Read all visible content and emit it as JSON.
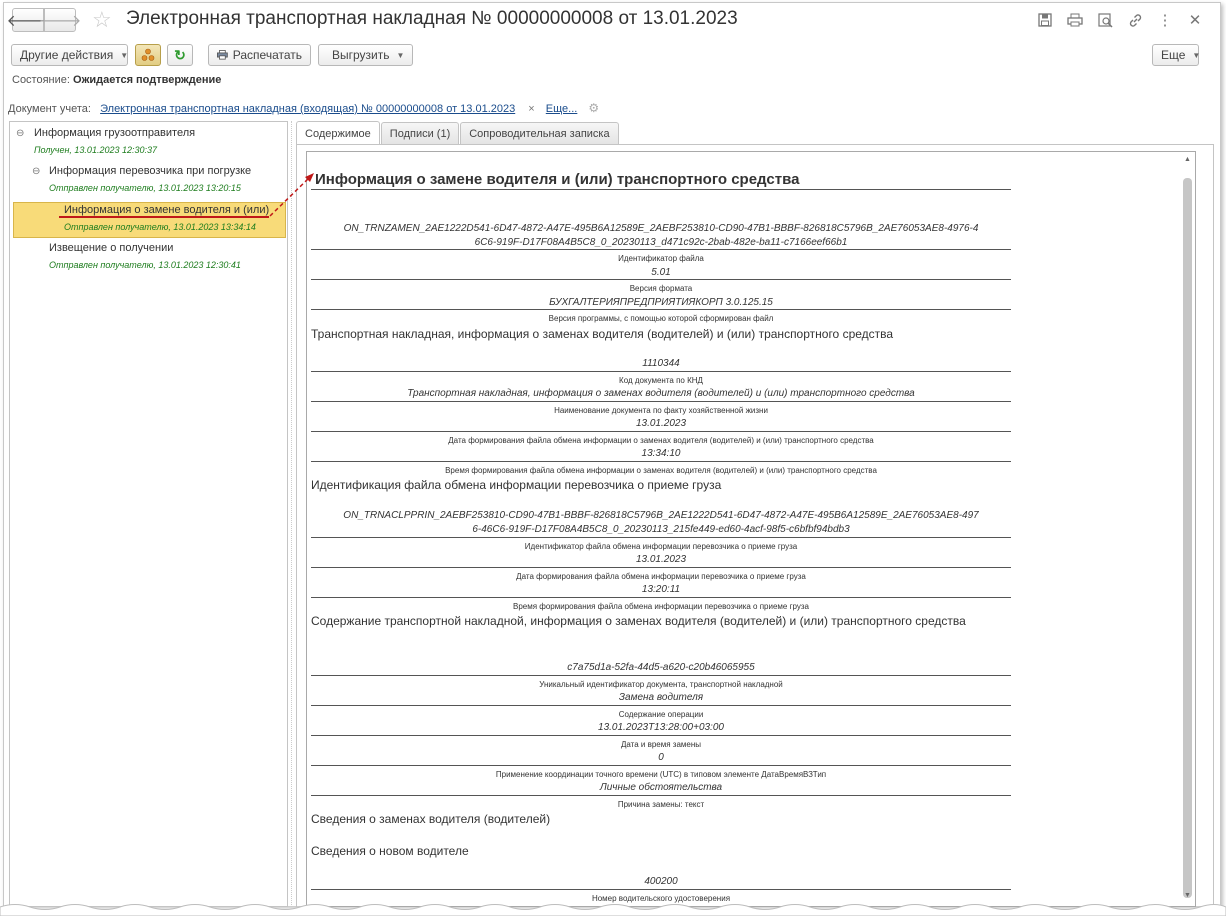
{
  "window": {
    "title": "Электронная транспортная накладная № 00000000008 от 13.01.2023"
  },
  "toolbar": {
    "other_actions": "Другие действия",
    "print": "Распечатать",
    "export": "Выгрузить",
    "more": "Еще"
  },
  "status": {
    "label": "Состояние:",
    "value": "Ожидается подтверждение"
  },
  "document": {
    "label": "Документ учета:",
    "link": "Электронная транспортная накладная (входящая) № 00000000008 от 13.01.2023",
    "clear": "×",
    "more_link": "Еще..."
  },
  "tree": {
    "items": [
      {
        "label": "Информация грузоотправителя",
        "sub": "Получен, 13.01.2023 12:30:37",
        "toggle": "⊖"
      },
      {
        "label": "Информация перевозчика при погрузке",
        "sub": "Отправлен получателю, 13.01.2023 13:20:15",
        "toggle": "⊖"
      },
      {
        "label": "Информация о замене водителя и (или)",
        "sub": "Отправлен получателю, 13.01.2023 13:34:14"
      },
      {
        "label": "Извещение о получении",
        "sub": "Отправлен получателю, 13.01.2023 12:30:41"
      }
    ]
  },
  "tabs": [
    {
      "label": "Содержимое"
    },
    {
      "label": "Подписи (1)"
    },
    {
      "label": "Сопроводительная записка"
    }
  ],
  "sheet": {
    "heading": "Информация о замене водителя и (или) транспортного средства",
    "file_id_line1": "ON_TRNZAMEN_2AE1222D541-6D47-4872-A47E-495B6A12589E_2AEBF253810-CD90-47B1-BBBF-826818C5796B_2AE76053AE8-4976-4",
    "file_id_line2": "6C6-919F-D17F08A4B5C8_0_20230113_d471c92c-2bab-482e-ba11-c7166eef66b1",
    "cap_file_id": "Идентификатор файла",
    "format_version": "5.01",
    "cap_format_version": "Версия формата",
    "program_version": "БУХГАЛТЕРИЯПРЕДПРИЯТИЯКОРП 3.0.125.15",
    "cap_program_version": "Версия программы, с помощью которой сформирован файл",
    "section1": "Транспортная накладная, информация о заменах водителя (водителей) и (или) транспортного средства",
    "knd": "1110344",
    "cap_knd": "Код документа по КНД",
    "doc_name": "Транспортная накладная, информация о заменах водителя (водителей) и (или) транспортного средства",
    "cap_doc_name": "Наименование документа по факту хозяйственной жизни",
    "form_date": "13.01.2023",
    "cap_form_date": "Дата формирования файла обмена информации о заменах водителя (водителей) и (или) транспортного средства",
    "form_time": "13:34:10",
    "cap_form_time": "Время формирования файла обмена информации о заменах водителя (водителей) и (или) транспортного средства",
    "section2": "Идентификация файла обмена информации перевозчика о приеме груза",
    "carrier_file_line1": "ON_TRNACLPPRIN_2AEBF253810-CD90-47B1-BBBF-826818C5796B_2AE1222D541-6D47-4872-A47E-495B6A12589E_2AE76053AE8-497",
    "carrier_file_line2": "6-46C6-919F-D17F08A4B5C8_0_20230113_215fe449-ed60-4acf-98f5-c6bfbf94bdb3",
    "cap_carrier_file": "Идентификатор файла обмена информации перевозчика о приеме груза",
    "carrier_date": "13.01.2023",
    "cap_carrier_date": "Дата формирования файла обмена информации перевозчика о приеме груза",
    "carrier_time": "13:20:11",
    "cap_carrier_time": "Время формирования файла обмена информации перевозчика о приеме груза",
    "section3": "Содержание транспортной накладной, информация о заменах водителя (водителей) и (или) транспортного средства",
    "uid": "c7a75d1a-52fa-44d5-a620-c20b46065955",
    "cap_uid": "Уникальный идентификатор документа, транспортной накладной",
    "operation": "Замена водителя",
    "cap_operation": "Содержание операции",
    "change_datetime": "13.01.2023T13:28:00+03:00",
    "cap_change_datetime": "Дата и время замены",
    "utc": "0",
    "cap_utc": "Применение координации точного времени (UTC) в типовом элементе ДатаВремяВЗТип",
    "reason": "Личные обстоятельства",
    "cap_reason": "Причина замены: текст",
    "section4": "Сведения о заменах водителя (водителей)",
    "section5": "Сведения о новом водителе",
    "license": "400200",
    "cap_license": "Номер водительского удостоверения"
  }
}
